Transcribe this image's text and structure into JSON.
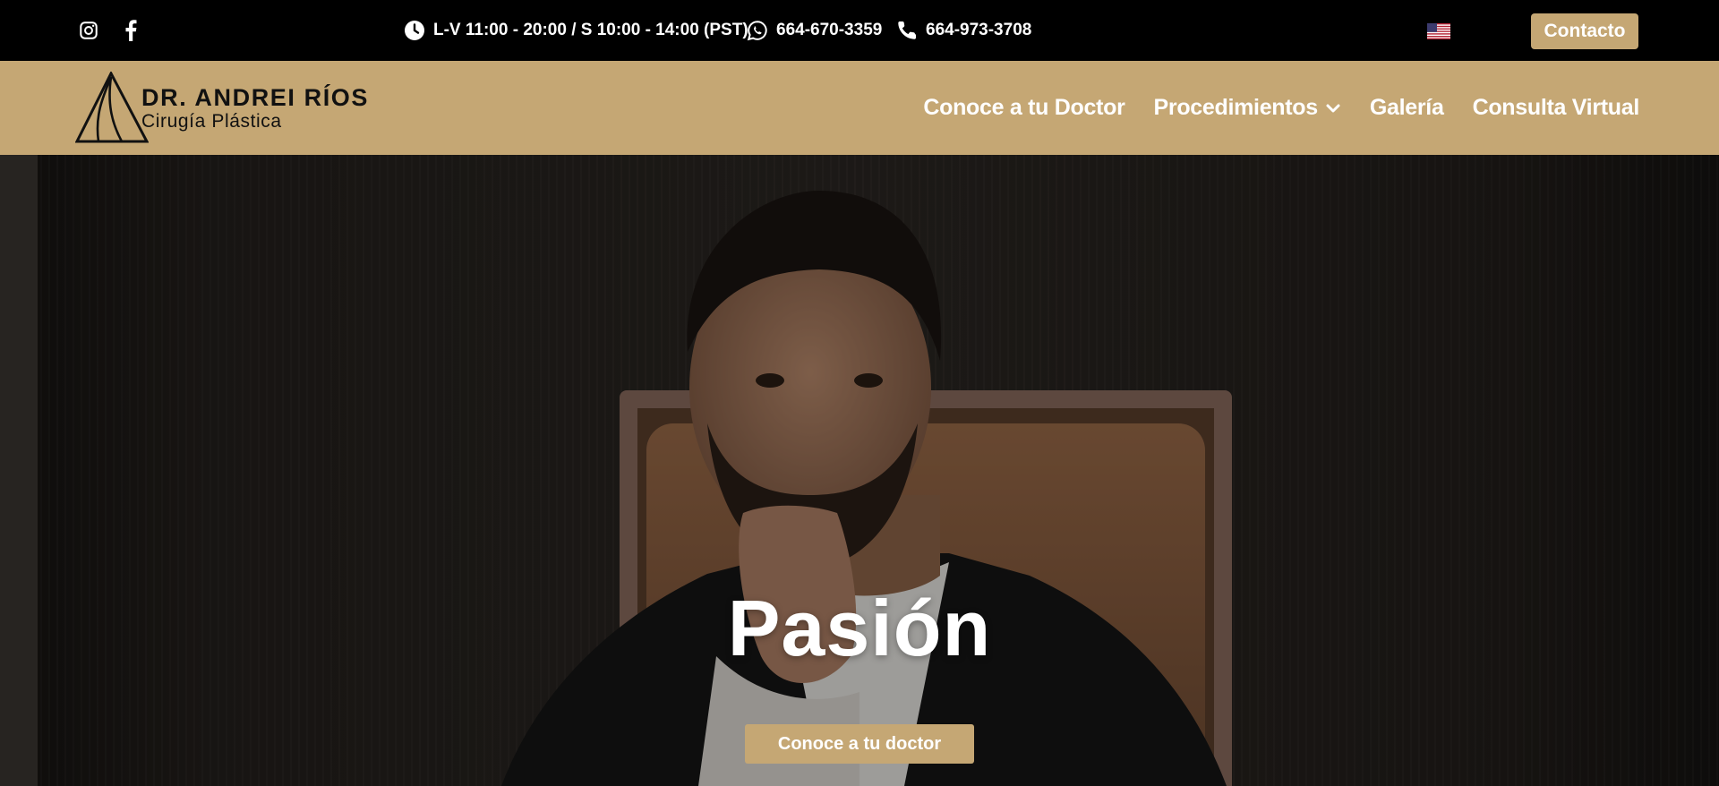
{
  "topbar": {
    "social": [
      {
        "icon": "instagram-icon"
      },
      {
        "icon": "facebook-icon"
      }
    ],
    "hours": "L-V 11:00 - 20:00 / S 10:00 - 14:00 (PST)",
    "whatsapp": "664-670-3359",
    "phone": "664-973-3708",
    "language_flag": "us-flag-icon",
    "contact_label": "Contacto"
  },
  "nav": {
    "logo": {
      "name": "DR. ANDREI RÍOS",
      "subtitle": "Cirugía Plástica"
    },
    "menu": [
      {
        "label": "Conoce a tu Doctor"
      },
      {
        "label": "Procedimientos",
        "has_dropdown": true
      },
      {
        "label": "Galería"
      },
      {
        "label": "Consulta Virtual"
      }
    ]
  },
  "hero": {
    "title": "Pasión",
    "button_label": "Conoce a tu doctor"
  },
  "colors": {
    "gold": "#c5a774",
    "black": "#000000",
    "white": "#ffffff"
  }
}
